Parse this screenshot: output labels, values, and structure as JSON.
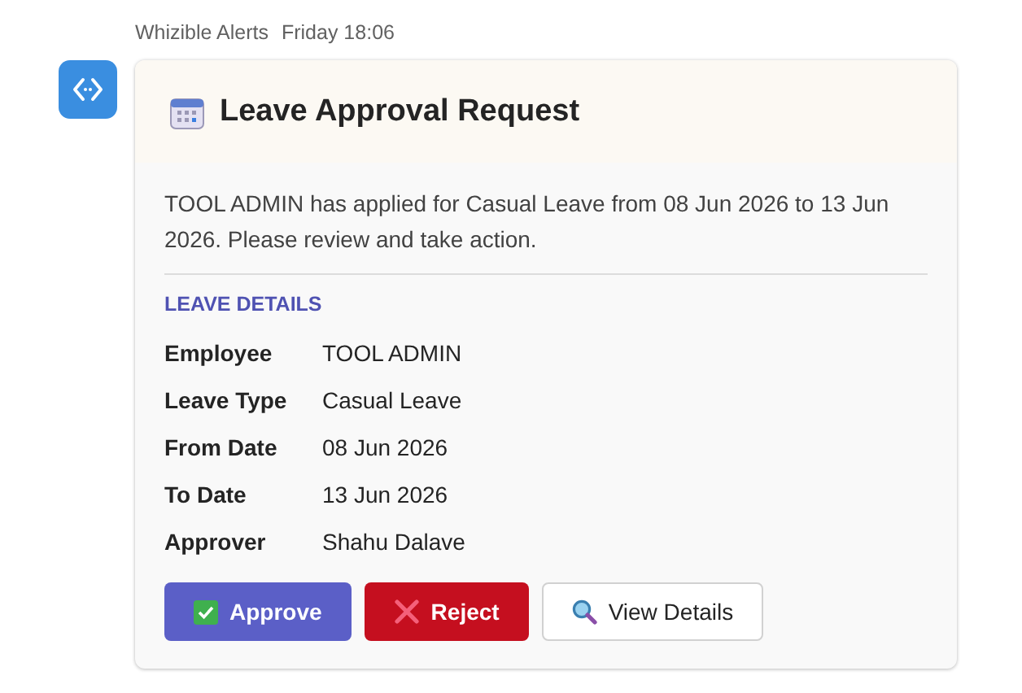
{
  "message": {
    "sender": "Whizible Alerts",
    "time": "Friday 18:06"
  },
  "card": {
    "title": "Leave Approval Request",
    "summary": "TOOL ADMIN has applied for Casual Leave from 08 Jun 2026 to 13 Jun 2026. Please review and take action.",
    "section_heading": "LEAVE DETAILS",
    "details": [
      {
        "label": "Employee",
        "value": "TOOL ADMIN"
      },
      {
        "label": "Leave Type",
        "value": "Casual Leave"
      },
      {
        "label": "From Date",
        "value": "08 Jun 2026"
      },
      {
        "label": "To Date",
        "value": "13 Jun 2026"
      },
      {
        "label": "Approver",
        "value": "Shahu Dalave"
      }
    ],
    "buttons": [
      {
        "label": "Approve",
        "kind": "primary"
      },
      {
        "label": "Reject",
        "kind": "danger"
      },
      {
        "label": "View Details",
        "kind": "default"
      }
    ]
  }
}
